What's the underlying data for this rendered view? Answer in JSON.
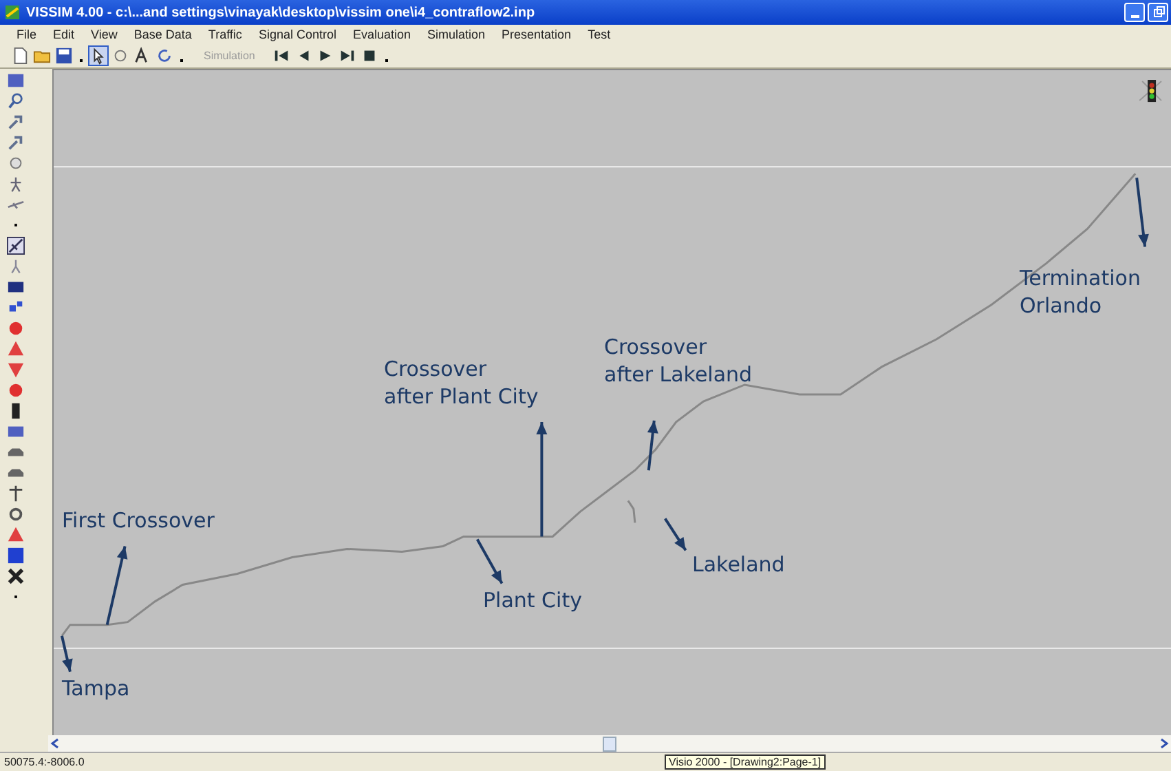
{
  "window": {
    "title": "VISSIM 4.00 - c:\\...and settings\\vinayak\\desktop\\vissim one\\i4_contraflow2.inp"
  },
  "menu": [
    "File",
    "Edit",
    "View",
    "Base Data",
    "Traffic",
    "Signal Control",
    "Evaluation",
    "Simulation",
    "Presentation",
    "Test"
  ],
  "toolbar": {
    "simulation_label": "Simulation"
  },
  "canvas": {
    "labels": [
      {
        "text": "Termination\nOrlando"
      },
      {
        "text": "Crossover\nafter Lakeland"
      },
      {
        "text": "Crossover\nafter Plant City"
      },
      {
        "text": "First Crossover"
      },
      {
        "text": "Lakeland"
      },
      {
        "text": "Plant City"
      },
      {
        "text": "Tampa"
      }
    ]
  },
  "status_bar": {
    "coordinates": "50075.4:-8006.0",
    "tooltip": "Visio 2000 - [Drawing2:Page-1]"
  }
}
